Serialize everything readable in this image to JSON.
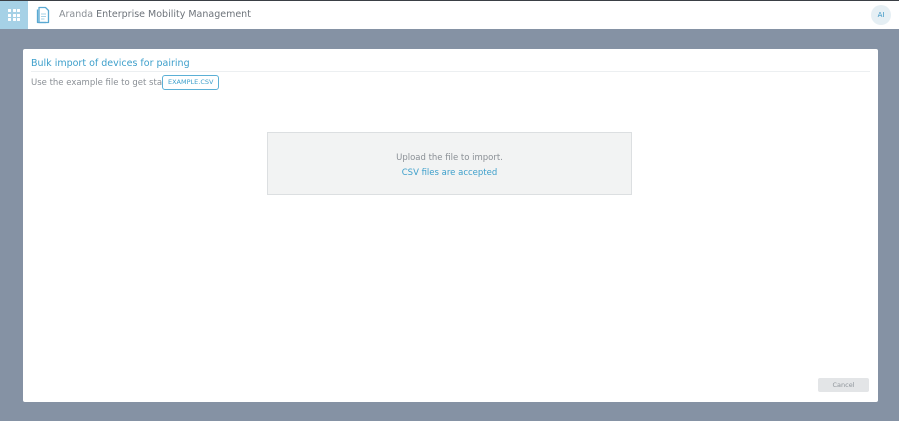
{
  "header": {
    "app_title_prefix": "Aranda",
    "app_title_name": "Enterprise Mobility Management",
    "user_initials": "AI",
    "apps_icon": "apps-grid-icon",
    "logo_icon": "document-logo-icon",
    "accent_color": "#a6d1e6"
  },
  "modal": {
    "title": "Bulk import of devices for pairing",
    "hint": "Use the example file to get started.",
    "example_button": "EXAMPLE.CSV",
    "dropzone": {
      "line1": "Upload the file to import.",
      "line2": "CSV files are accepted"
    },
    "cancel_button": "Cancel"
  },
  "colors": {
    "backdrop": "#8592a4",
    "link_blue": "#3d9fcb",
    "muted_text": "#8a8f95"
  }
}
